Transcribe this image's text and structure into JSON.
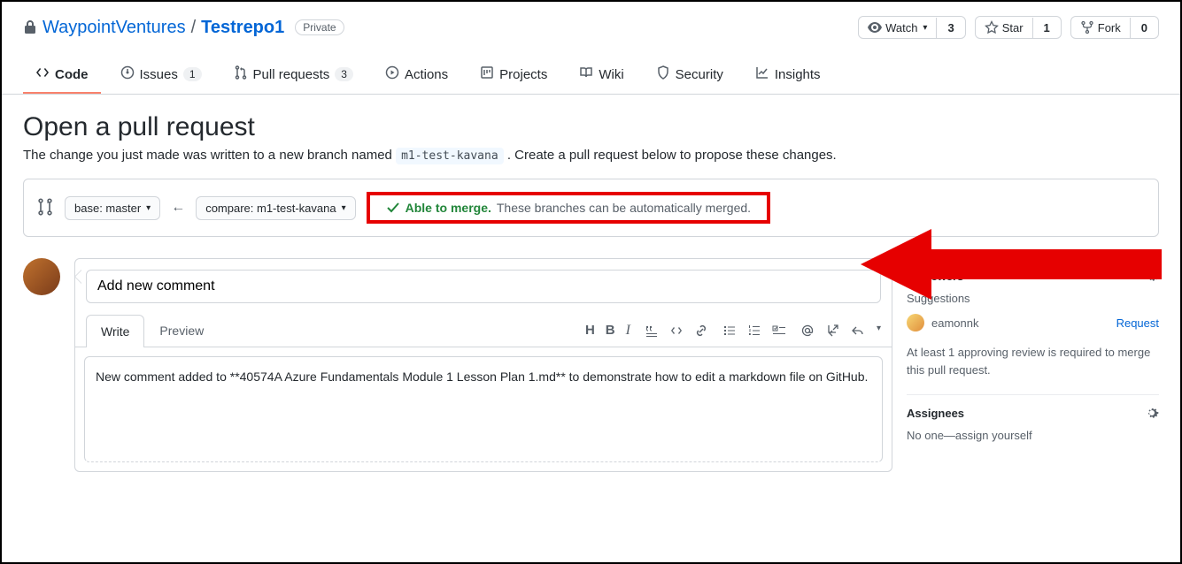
{
  "repo": {
    "owner": "WaypointVentures",
    "name": "Testrepo1",
    "privacy": "Private"
  },
  "actions": {
    "watch": {
      "label": "Watch",
      "count": "3"
    },
    "star": {
      "label": "Star",
      "count": "1"
    },
    "fork": {
      "label": "Fork",
      "count": "0"
    }
  },
  "nav": {
    "code": "Code",
    "issues": "Issues",
    "issues_count": "1",
    "pulls": "Pull requests",
    "pulls_count": "3",
    "actions": "Actions",
    "projects": "Projects",
    "wiki": "Wiki",
    "security": "Security",
    "insights": "Insights"
  },
  "pr": {
    "heading": "Open a pull request",
    "subtitle_pre": "The change you just made was written to a new branch named ",
    "branch": "m1-test-kavana",
    "subtitle_post": " . Create a pull request below to propose these changes.",
    "base_label": "base: master",
    "compare_label": "compare: m1-test-kavana",
    "merge_status": "Able to merge.",
    "merge_detail": "These branches can be automatically merged."
  },
  "comment": {
    "title_placeholder": "Add new comment",
    "tab_write": "Write",
    "tab_preview": "Preview",
    "body": "New comment added to **40574A Azure Fundamentals Module 1 Lesson Plan 1.md** to demonstrate how to edit a markdown file on GitHub."
  },
  "sidebar": {
    "reviewers": {
      "title": "Reviewers",
      "suggestions": "Suggestions",
      "user": "eamonnk",
      "request": "Request",
      "note": "At least 1 approving review is required to merge this pull request."
    },
    "assignees": {
      "title": "Assignees",
      "text": "No one—assign yourself"
    }
  }
}
